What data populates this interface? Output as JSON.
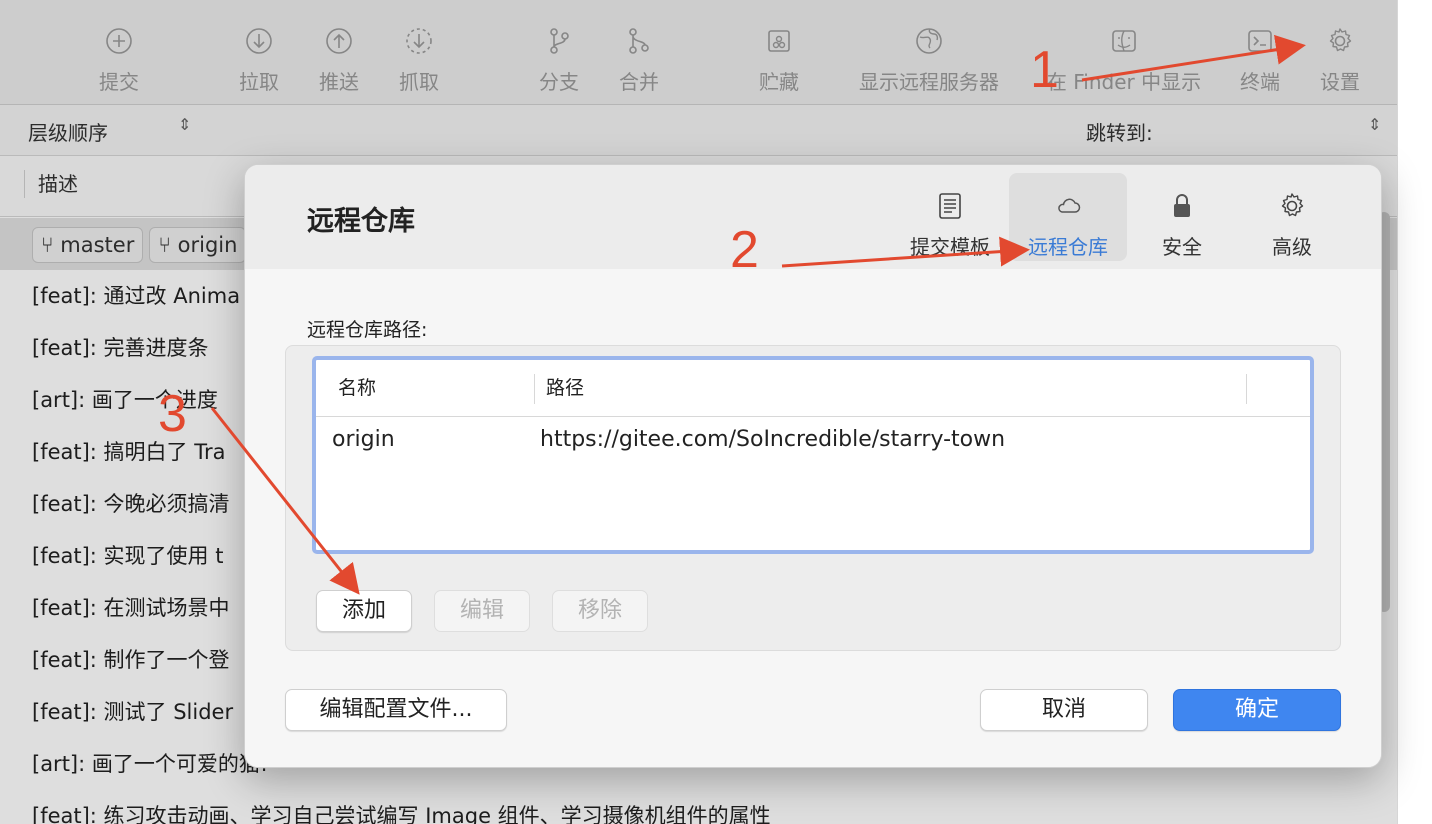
{
  "toolbar": {
    "items": [
      {
        "label": "提交",
        "icon": "plus-circle-icon"
      },
      {
        "label": "拉取",
        "icon": "arrow-down-circle-icon"
      },
      {
        "label": "推送",
        "icon": "arrow-up-circle-icon"
      },
      {
        "label": "抓取",
        "icon": "arrow-down-dashed-circle-icon"
      },
      {
        "label": "分支",
        "icon": "branch-icon"
      },
      {
        "label": "合并",
        "icon": "merge-icon"
      },
      {
        "label": "贮藏",
        "icon": "stash-icon"
      },
      {
        "label": "显示远程服务器",
        "icon": "globe-icon"
      },
      {
        "label": "在 Finder 中显示",
        "icon": "finder-icon"
      },
      {
        "label": "终端",
        "icon": "terminal-icon"
      },
      {
        "label": "设置",
        "icon": "gear-icon"
      }
    ]
  },
  "sortbar": {
    "order_label": "层级顺序",
    "jump_label": "跳转到:"
  },
  "columns": {
    "description": "描述"
  },
  "commits": {
    "branch_tags": [
      "master",
      "origin"
    ],
    "rows": [
      "[feat]: 通过改 Anima",
      "[feat]: 完善进度条",
      "[art]: 画了一个进度",
      "[feat]: 搞明白了 Tra",
      "[feat]: 今晚必须搞清",
      "[feat]: 实现了使用 t",
      "[feat]: 在测试场景中",
      "[feat]: 制作了一个登",
      "[feat]: 测试了 Slider",
      "[art]: 画了一个可爱的猫!",
      "[feat]: 练习攻击动画、学习自己尝试编写 Image 组件、学习摄像机组件的属性"
    ]
  },
  "dialog": {
    "title": "远程仓库",
    "tabs": [
      {
        "label": "提交模板",
        "icon": "document-icon",
        "active": false
      },
      {
        "label": "远程仓库",
        "icon": "cloud-icon",
        "active": true
      },
      {
        "label": "安全",
        "icon": "lock-icon",
        "active": false
      },
      {
        "label": "高级",
        "icon": "gear-icon",
        "active": false
      }
    ],
    "section_label": "远程仓库路径:",
    "table": {
      "headers": [
        "名称",
        "路径"
      ],
      "rows": [
        {
          "name": "origin",
          "path": "https://gitee.com/SoIncredible/starry-town"
        }
      ]
    },
    "buttons": {
      "add": "添加",
      "edit": "编辑",
      "remove": "移除",
      "edit_config": "编辑配置文件...",
      "cancel": "取消",
      "ok": "确定"
    }
  },
  "annotations": {
    "numbers": [
      "1",
      "2",
      "3"
    ],
    "color": "#e2492f"
  },
  "colors": {
    "accent": "#3f86f0",
    "selection_ring": "#9ab5ec",
    "active_tab_text": "#3a7bd5"
  }
}
